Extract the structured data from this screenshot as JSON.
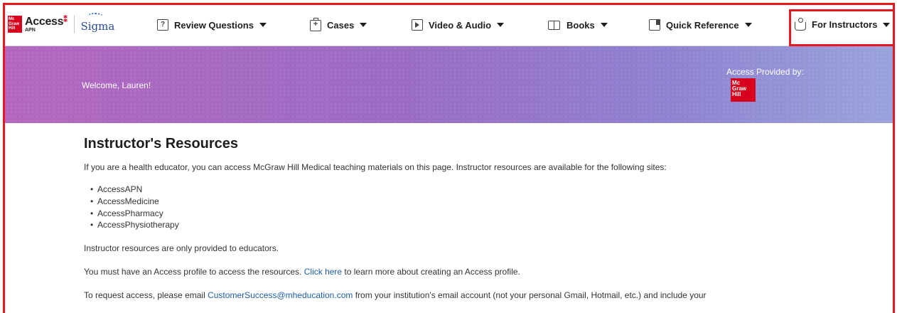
{
  "brand": {
    "mh_logo_lines": [
      "Mc",
      "Graw",
      "Hill"
    ],
    "access_word": "Access",
    "access_sub": "APN",
    "partner": "Sigma"
  },
  "nav": {
    "items": [
      {
        "label": "Review Questions",
        "icon": "question-box-icon",
        "icon_glyph": "?"
      },
      {
        "label": "Cases",
        "icon": "medical-kit-icon",
        "icon_glyph": "+"
      },
      {
        "label": "Video & Audio",
        "icon": "play-icon",
        "icon_glyph": ""
      },
      {
        "label": "Books",
        "icon": "open-book-icon",
        "icon_glyph": ""
      },
      {
        "label": "Quick Reference",
        "icon": "reference-card-icon",
        "icon_glyph": ""
      },
      {
        "label": "For Instructors",
        "icon": "instructor-icon",
        "icon_glyph": ""
      }
    ],
    "highlighted_item": "For Instructors",
    "highlight_color": "#e8161d"
  },
  "banner": {
    "welcome": "Welcome, Lauren!",
    "access_provided_by": "Access Provided by:",
    "provider_logo_lines": [
      "Mc",
      "Graw",
      "Hill"
    ],
    "colors": [
      "#b367bf",
      "#9a6cc4",
      "#8f82d0",
      "#9aa3dc"
    ]
  },
  "main": {
    "title": "Instructor's Resources",
    "intro": "If you are a health educator, you can access McGraw Hill Medical teaching materials on this page. Instructor resources are available for the following sites:",
    "sites": [
      "AccessAPN",
      "AccessMedicine",
      "AccessPharmacy",
      "AccessPhysiotherapy"
    ],
    "educators_note": "Instructor resources are only provided to educators.",
    "profile_before": "You must have an Access profile to access the resources. ",
    "profile_link": "Click here",
    "profile_after": " to learn more about creating an Access profile.",
    "request_before": "To request access, please email ",
    "request_email": "CustomerSuccess@mheducation.com",
    "request_after": " from your institution's email account (not your personal Gmail, Hotmail, etc.) and include your",
    "link_color": "#1e5ea8"
  }
}
